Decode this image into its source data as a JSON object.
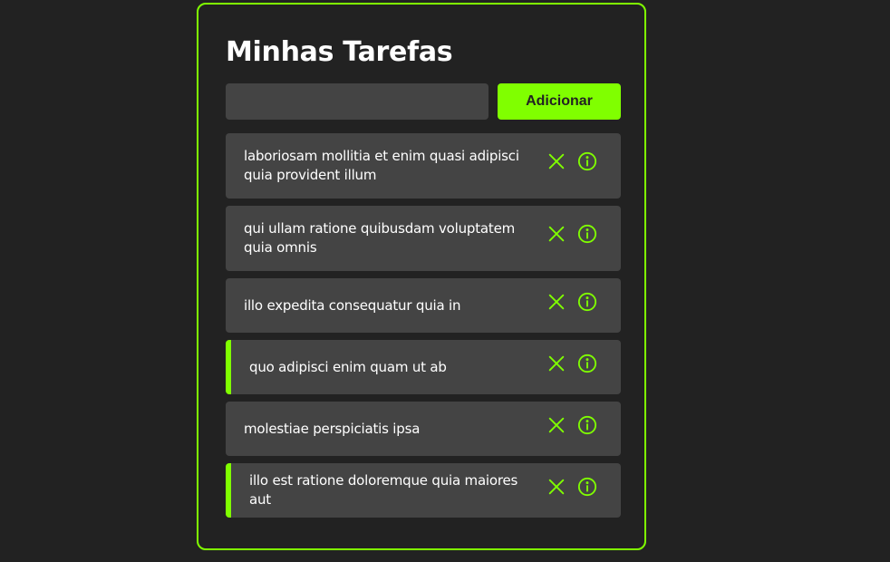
{
  "app": {
    "title": "Minhas Tarefas",
    "accent_color": "#80ff00"
  },
  "add_form": {
    "input_value": "",
    "input_placeholder": "",
    "button_label": "Adicionar"
  },
  "tasks": [
    {
      "text": "laboriosam mollitia et enim quasi adipisci quia provident illum",
      "completed": false
    },
    {
      "text": "qui ullam ratione quibusdam voluptatem quia omnis",
      "completed": false
    },
    {
      "text": "illo expedita consequatur quia in",
      "completed": false
    },
    {
      "text": "quo adipisci enim quam ut ab",
      "completed": true
    },
    {
      "text": "molestiae perspiciatis ipsa",
      "completed": false
    },
    {
      "text": "illo est ratione doloremque quia maiores aut",
      "completed": true
    }
  ],
  "icons": {
    "remove": "close-icon",
    "details": "info-icon"
  }
}
